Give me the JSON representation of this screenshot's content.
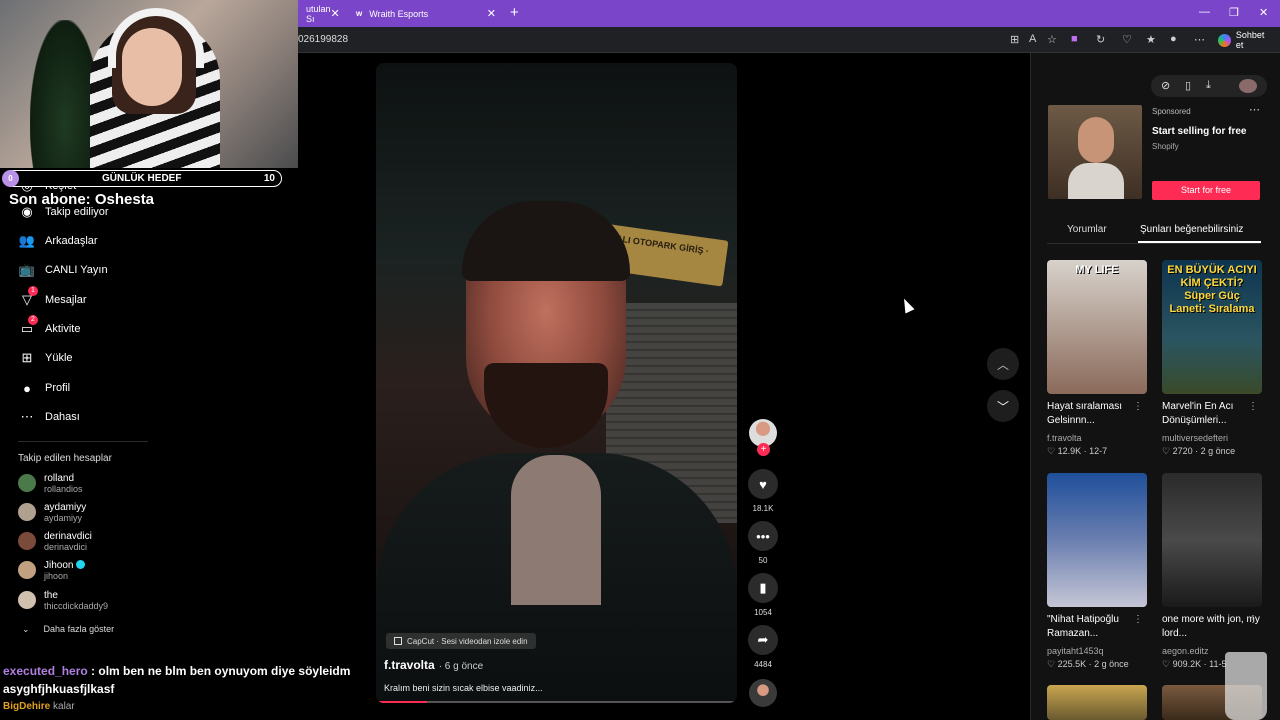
{
  "browser": {
    "tabs": [
      {
        "label": "utulan Sı",
        "favicon": "tiktok-icon"
      },
      {
        "label": "Wraith Esports",
        "favicon": "w"
      }
    ],
    "url": "026199828",
    "chat_button": "Sohbet et"
  },
  "overlay": {
    "goal_current": "0",
    "goal_title": "GÜNLÜK HEDEF",
    "goal_max": "10",
    "last_sub": "Son abone: Oshesta",
    "chat": [
      {
        "user": "executed_hero",
        "message": " : olm ben ne blm ben oynuyom diye söyleidm"
      },
      {
        "user": "",
        "message": "asyghfjhkuasfjlkasf"
      }
    ],
    "donor_partial": "BigDehire",
    "donor_suffix": "kalar"
  },
  "sidebar": {
    "nav": [
      {
        "label": "Keşfet",
        "icon": "compass-icon"
      },
      {
        "label": "Takip ediliyor",
        "icon": "following-icon"
      },
      {
        "label": "Arkadaşlar",
        "icon": "friends-icon"
      },
      {
        "label": "CANLI Yayın",
        "icon": "live-icon"
      },
      {
        "label": "Mesajlar",
        "icon": "message-icon",
        "badge": "1"
      },
      {
        "label": "Aktivite",
        "icon": "activity-icon",
        "badge": "2"
      },
      {
        "label": "Yükle",
        "icon": "upload-icon"
      },
      {
        "label": "Profil",
        "icon": "profile-icon"
      },
      {
        "label": "Dahası",
        "icon": "more-icon"
      }
    ],
    "following_title": "Takip edilen hesaplar",
    "following": [
      {
        "name": "rolland",
        "handle": "rollandios",
        "color": "#4a7a4a"
      },
      {
        "name": "aydamiyy",
        "handle": "aydamiyy",
        "color": "#b0a090"
      },
      {
        "name": "derinavdici",
        "handle": "derinavdici",
        "color": "#7a4a3a"
      },
      {
        "name": "Jihoon",
        "handle": "jihoon",
        "color": "#c0a080",
        "verified": true
      },
      {
        "name": "the",
        "handle": "thiccdickdaddy9",
        "color": "#d0c0b0"
      }
    ],
    "show_more": "Daha fazla göster"
  },
  "video": {
    "capcut": "CapCut · Sesi videodan izole edin",
    "author": "f.travolta",
    "time": "· 6 g önce",
    "caption": "Kralım beni sizin sıcak elbise vaadiniz... ",
    "sign_text": "KAPALI OTOPARK GİRİŞ · ÇIKIŞ",
    "progress": 0.14,
    "likes": "18.1K",
    "comments": "50",
    "saves": "1054",
    "shares": "4484"
  },
  "right_panel": {
    "ad": {
      "sponsored": "Sponsored",
      "title": "Start selling for free",
      "brand": "Shopify",
      "cta": "Start for free"
    },
    "tabs": [
      "Yorumlar",
      "Şunları beğenebilirsiniz"
    ],
    "cards": [
      {
        "title": "Hayat sıralaması Gelsinnn...",
        "author": "f.travolta",
        "likes": "12.9K",
        "date": "12-7",
        "overlay": "MY LIFE",
        "bg": "linear-gradient(180deg,#d8d2cc,#8a6a5a)"
      },
      {
        "title": "Marvel'in En Acı Dönüşümleri...",
        "author": "multiversedefteri",
        "likes": "2720",
        "date": "2 g önce",
        "overlay": "EN BÜYÜK ACIYI KİM ÇEKTİ? Süper Güç Laneti: Sıralama",
        "bg": "linear-gradient(180deg,#0d3550,#2a5560 60%,#3a4a2a)"
      },
      {
        "title": "\"Nihat Hatipoğlu Ramazan...",
        "author": "payitaht1453q",
        "likes": "225.5K",
        "date": "2 g önce",
        "overlay": "",
        "bg": "linear-gradient(180deg,#1f4f9a,#6a7fb0 50%,#c6c6d6)"
      },
      {
        "title": "one more with jon, my lord...",
        "author": "aegon.editz",
        "likes": "909.2K",
        "date": "11-5",
        "overlay": "",
        "bg": "linear-gradient(180deg,#2a2a2a,#4a4a4a 50%,#1a1a1a)"
      }
    ]
  }
}
